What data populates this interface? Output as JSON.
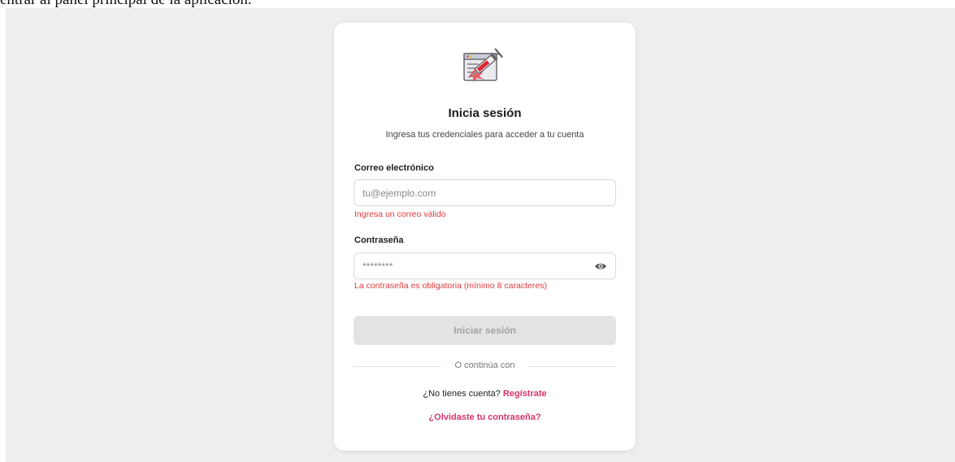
{
  "caption": "entrar al panel principal de la aplicación.",
  "login": {
    "title": "Inicia sesión",
    "subtitle": "Ingresa tus credenciales para acceder a tu cuenta",
    "email": {
      "label": "Correo electrónico",
      "placeholder": "tu@ejemplo.com",
      "value": "",
      "error": "Ingresa un correo válido"
    },
    "password": {
      "label": "Contraseña",
      "placeholder": "********",
      "value": "",
      "error": "La contraseña es obligatoria (mínimo 8 caracteres)",
      "toggle_icon": "eye-icon"
    },
    "submit_label": "Iniciar sesión",
    "divider_text": "O continúa con",
    "signup_prompt": "¿No tienes cuenta?",
    "signup_link": "Regístrate",
    "forgot_link": "¿Olvidaste tu contraseña?"
  },
  "colors": {
    "background": "#efeded",
    "error": "#e23a3a",
    "link": "#d6336c",
    "button_disabled": "#e3e3e3"
  },
  "icons": {
    "logo": "syringe-document-icon"
  }
}
